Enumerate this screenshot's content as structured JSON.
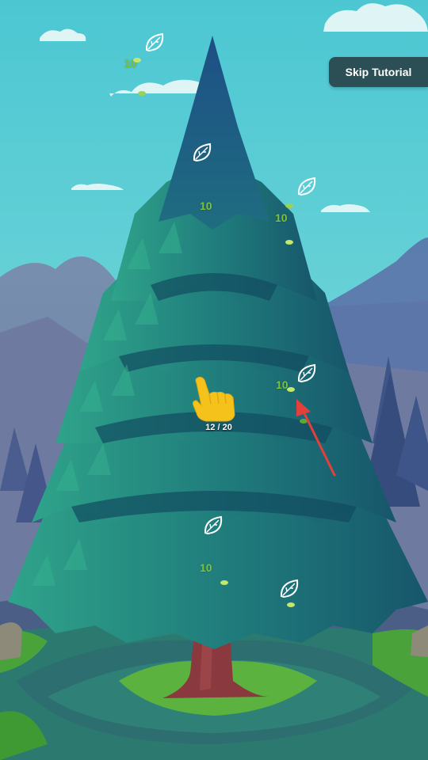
{
  "hud": {
    "skip_label": "Skip Tutorial",
    "progress_text": "12 / 20",
    "progress": {
      "current": 12,
      "total": 20
    }
  },
  "points_label": "10",
  "colors": {
    "sky": "#4fc6d0",
    "tree_dark": "#17566b",
    "tree_mid": "#1f7a7b",
    "tree_light": "#2fa38a",
    "trunk": "#8a3a3e",
    "skip_button_bg": "#2b4f55",
    "points_text": "#7bc13b",
    "hand": "#f4c21a",
    "arrow": "#e2403a"
  },
  "icons": {
    "leaf_marker": "leaf-outline-icon",
    "pointer": "pointing-hand-icon",
    "arrow": "arrow-icon"
  }
}
